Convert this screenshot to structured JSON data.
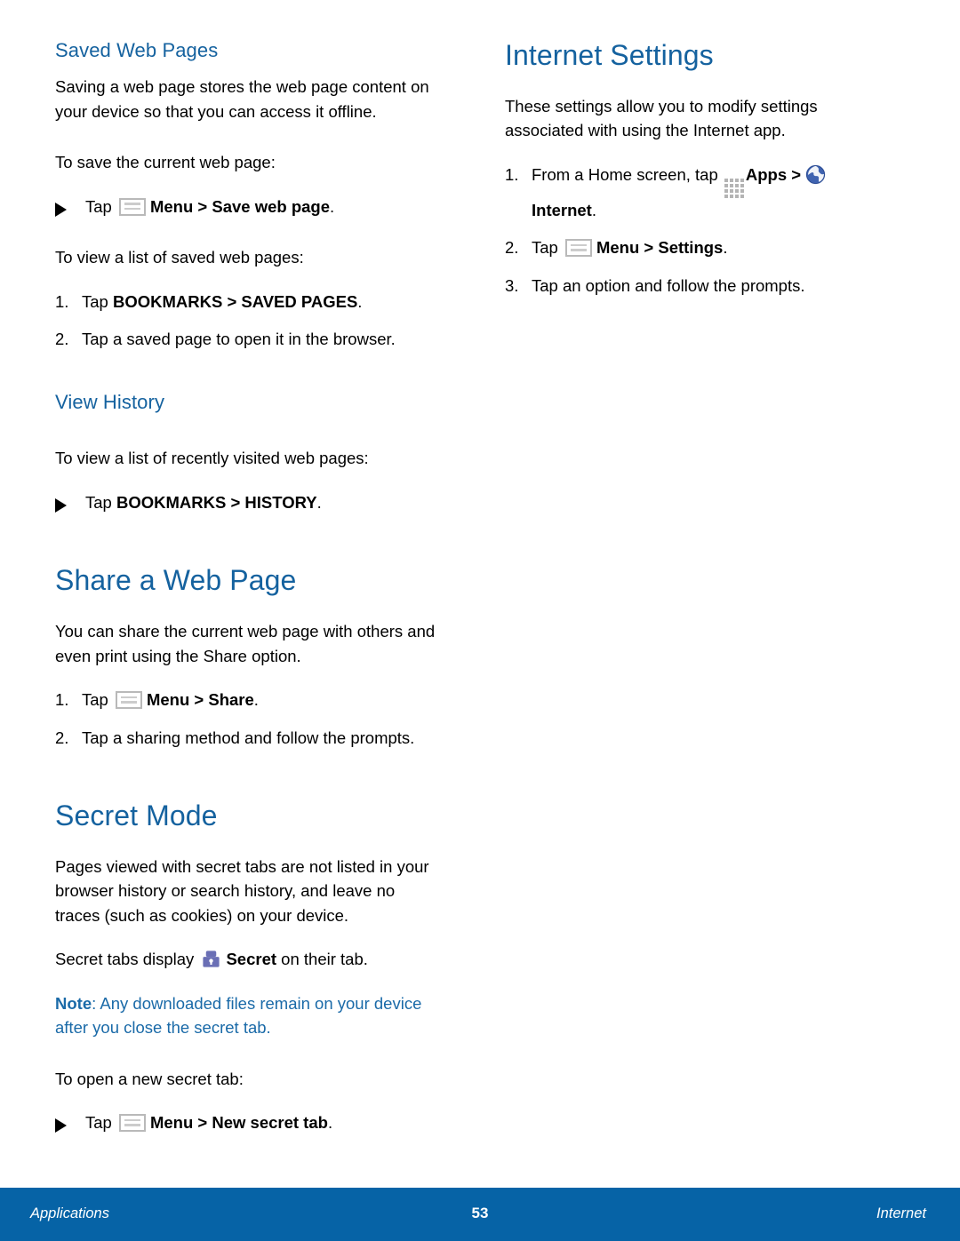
{
  "document": {
    "left_column": {
      "sections": [
        {
          "id": "saved-web-pages",
          "heading": "Saved Web Pages",
          "heading_level": "minor",
          "intro": "Saving a web page stores the web page content on your device so that you can access it offline.",
          "lead_1": "To save the current web page:",
          "bullet_1_pre": "Tap",
          "bullet_1_bold": "Menu > Save web page",
          "bullet_1_post": ".",
          "lead_2": "To view a list of saved web pages:",
          "step_1_num": "1.",
          "step_1_pre": "Tap",
          "step_1_bold": "BOOKMARKS > SAVED PAGES",
          "step_1_post": ".",
          "step_2_num": "2.",
          "step_2_text": "Tap a saved page to open it in the browser."
        },
        {
          "id": "view-history",
          "heading": "View History",
          "heading_level": "minor",
          "lead_1": "To view a list of recently visited web pages:",
          "bullet_1_pre": "Tap",
          "bullet_1_bold": "BOOKMARKS > HISTORY",
          "bullet_1_post": "."
        },
        {
          "id": "share-a-web-page",
          "heading": "Share a Web Page",
          "heading_level": "major",
          "intro": "You can share the current web page with others and even print using the Share option.",
          "step_1_num": "1.",
          "step_1_pre": "Tap",
          "step_1_bold": "Menu > Share",
          "step_1_post": ".",
          "step_2_num": "2.",
          "step_2_text": "Tap a sharing method and follow the prompts."
        },
        {
          "id": "secret-mode",
          "heading": "Secret Mode",
          "heading_level": "major",
          "intro": "Pages viewed with secret tabs are not listed in your browser history or search history, and leave no traces (such as cookies) on your device.",
          "display_pre": "Secret tabs display",
          "display_bold": "Secret",
          "display_post": "on their tab.",
          "note_label": "Note",
          "note_text": ": Any downloaded files remain on your device after you close the secret tab.",
          "lead_1": "To open a new secret tab:",
          "bullet_1_pre": "Tap",
          "bullet_1_bold": "Menu > New secret tab",
          "bullet_1_post": "."
        }
      ]
    },
    "right_column": {
      "sections": [
        {
          "id": "internet-settings",
          "heading": "Internet Settings",
          "heading_level": "major",
          "intro": "These settings allow you to modify settings associated with using the Internet app.",
          "step_1_num": "1.",
          "step_1_pre": "From a Home screen, tap",
          "step_1_bold_apps": "Apps",
          "step_1_sep": ">",
          "step_1_bold_internet": "Internet",
          "step_1_post": ".",
          "step_2_num": "2.",
          "step_2_pre": "Tap",
          "step_2_bold": "Menu > Settings",
          "step_2_post": ".",
          "step_3_num": "3.",
          "step_3_text": "Tap an option and follow the prompts."
        }
      ]
    }
  },
  "footer": {
    "left": "Applications",
    "page_number": "53",
    "right": "Internet"
  },
  "colors": {
    "heading_blue": "#15629f",
    "note_blue": "#1a6aa8",
    "footer_blue": "#0663a6",
    "icon_gray": "#b4b4b4",
    "lock_purple": "#6a6fb5",
    "globe_blue": "#3f63b0"
  },
  "icons": {
    "menu": "menu-icon",
    "apps": "apps-grid-icon",
    "internet": "globe-icon",
    "secret": "lock-icon",
    "bullet": "triangle-bullet-icon"
  }
}
